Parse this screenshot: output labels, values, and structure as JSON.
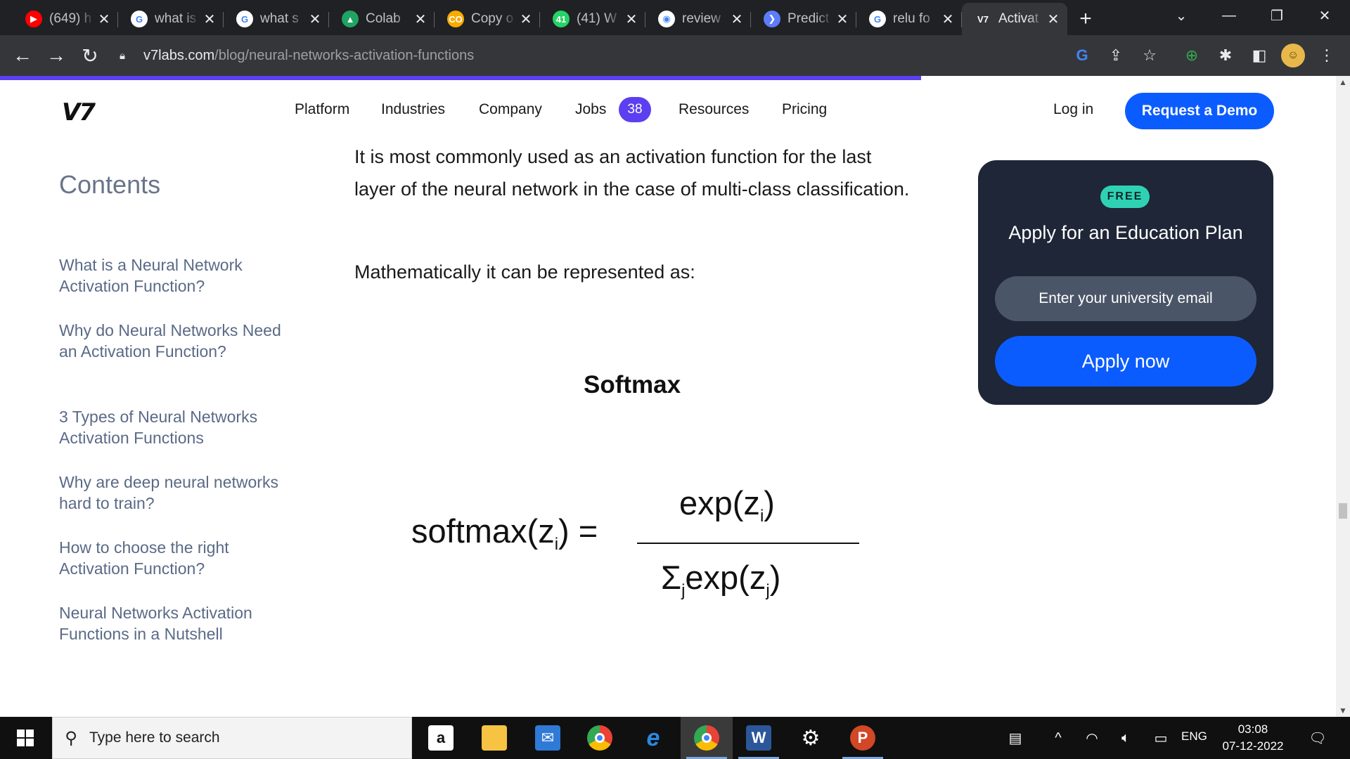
{
  "browser": {
    "tabs": [
      {
        "title": "(649) h",
        "icon": "youtube-icon",
        "color": "#ff0000",
        "glyph": "▶"
      },
      {
        "title": "what is",
        "icon": "google-icon",
        "color": "#ffffff",
        "glyph": "G"
      },
      {
        "title": "what s",
        "icon": "google-icon",
        "color": "#ffffff",
        "glyph": "G"
      },
      {
        "title": "Colab",
        "icon": "google-drive-icon",
        "color": "#1fa463",
        "glyph": "▲"
      },
      {
        "title": "Copy o",
        "icon": "colab-icon",
        "color": "#f9ab00",
        "glyph": "CO"
      },
      {
        "title": "(41) W",
        "icon": "whatsapp-icon",
        "color": "#25d366",
        "glyph": "41"
      },
      {
        "title": "review",
        "icon": "globe-icon",
        "color": "#ffffff",
        "glyph": "◉"
      },
      {
        "title": "Predict",
        "icon": "bookmark-icon",
        "color": "#5c7cfa",
        "glyph": "❯"
      },
      {
        "title": "relu fo",
        "icon": "google-icon",
        "color": "#ffffff",
        "glyph": "G"
      },
      {
        "title": "Activat",
        "icon": "v7-icon",
        "color": "#35363a",
        "glyph": "V7"
      }
    ],
    "url_host": "v7labs.com",
    "url_path": "/blog/neural-networks-activation-functions"
  },
  "site": {
    "logo": "V7",
    "nav": [
      "Platform",
      "Industries",
      "Company",
      "Jobs",
      "Resources",
      "Pricing"
    ],
    "jobs_count": "38",
    "login": "Log in",
    "demo": "Request a Demo"
  },
  "sidebar": {
    "title": "Contents",
    "items": [
      "What is a Neural Network Activation Function?",
      "Why do Neural Networks Need an Activation Function?",
      "3 Types of Neural Networks Activation Functions",
      "Why are deep neural networks hard to train?",
      "How to choose the right Activation Function?",
      "Neural Networks Activation Functions in a Nutshell"
    ]
  },
  "article": {
    "paragraph1": "It is most commonly used as an activation function for the last layer of the neural network in the case of multi-class classification.",
    "paragraph2": "Mathematically it can be represented as:",
    "formula_caption": "Softmax",
    "formula": {
      "lhs_fn": "softmax(z",
      "lhs_sub": "i",
      "lhs_tail": ") =",
      "num_fn": "exp(z",
      "num_sub": "i",
      "num_tail": ")",
      "den_sigma": "Σ",
      "den_sigma_sub": "j",
      "den_fn": "exp(z",
      "den_sub": "j",
      "den_tail": ")"
    }
  },
  "edu_card": {
    "badge": "FREE",
    "title": "Apply for an Education Plan",
    "email_placeholder": "Enter your university email",
    "apply": "Apply now"
  },
  "taskbar": {
    "search_placeholder": "Type here to search",
    "lang": "ENG",
    "time": "03:08",
    "date": "07-12-2022"
  },
  "colors": {
    "accent_purple": "#5b3ff0",
    "brand_blue": "#0b5cff",
    "card_dark": "#1e2637",
    "badge_teal": "#2fd1b4"
  }
}
